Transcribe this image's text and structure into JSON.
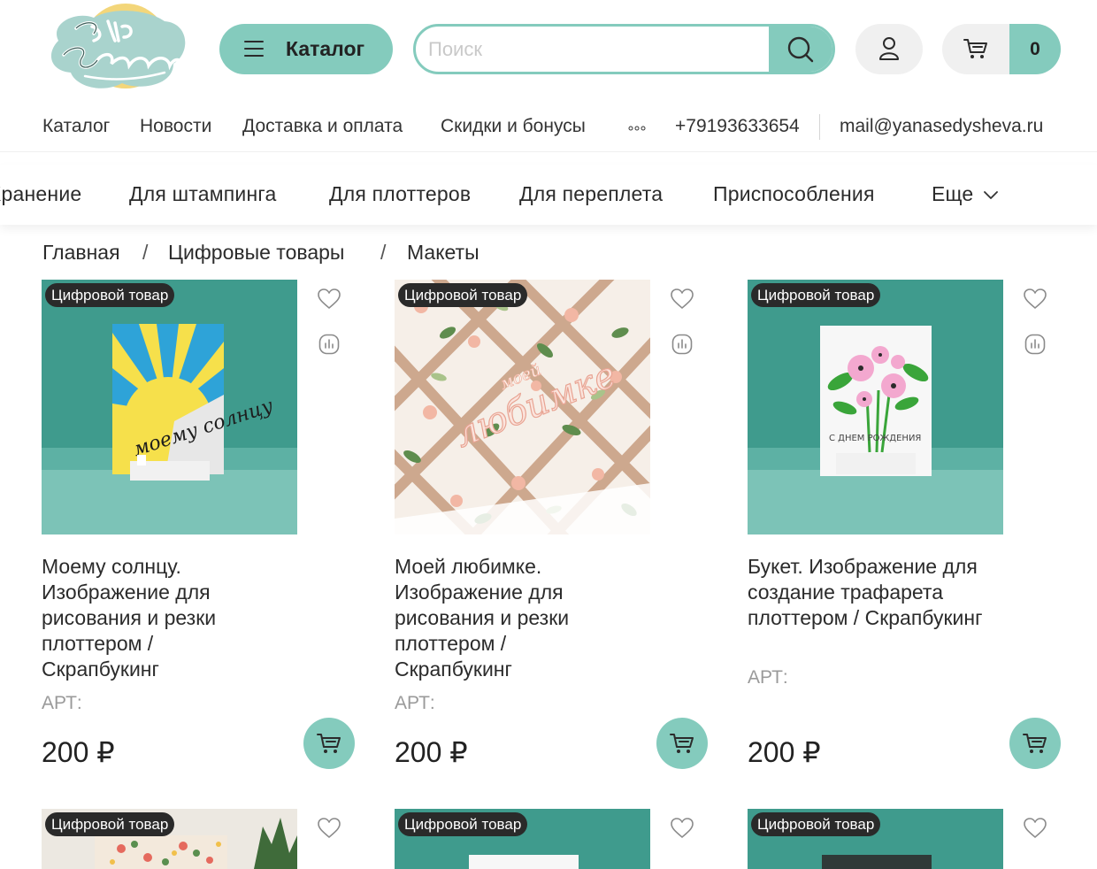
{
  "header": {
    "logo_text": "Яна Седышева",
    "catalog_label": "Каталог",
    "search_placeholder": "Поиск",
    "cart_count": "0"
  },
  "topnav": {
    "items": [
      "Каталог",
      "Новости",
      "Доставка и оплата",
      "Скидки и бонусы"
    ],
    "more_label": "more-dots-icon",
    "phone": "+79193633654",
    "email": "mail@yanasedysheva.ru"
  },
  "categories": {
    "items": [
      "Хранение",
      "Для штампинга",
      "Для плоттеров",
      "Для переплета",
      "Приспособления"
    ],
    "more_label": "Еще"
  },
  "breadcrumb": {
    "items": [
      "Главная",
      "Цифровые товары",
      "Макеты"
    ],
    "separator": "/"
  },
  "products": [
    {
      "badge": "Цифровой товар",
      "title": "Моему солнцу. Изображение для рисования и резки плоттером / Скрапбукинг",
      "art": "АРТ:",
      "price": "200 ₽",
      "image_text": "моему солнцу"
    },
    {
      "badge": "Цифровой товар",
      "title": "Моей любимке. Изображение для рисования и резки плоттером / Скрапбукинг",
      "art": "АРТ:",
      "price": "200 ₽",
      "image_text_small": "моей",
      "image_text_large": "любимке"
    },
    {
      "badge": "Цифровой товар",
      "title": "Букет. Изображение для создание трафарета плоттером / Скрапбукинг",
      "art": "АРТ:",
      "price": "200 ₽",
      "image_text": "С ДНЕМ РОЖДЕНИЯ"
    }
  ],
  "products_row2": [
    {
      "badge": "Цифровой товар"
    },
    {
      "badge": "Цифровой товар"
    },
    {
      "badge": "Цифровой товар"
    }
  ],
  "colors": {
    "accent": "#84cbbd",
    "product_bg": "#3f9b8d",
    "badge_bg": "#2a2a2a"
  }
}
